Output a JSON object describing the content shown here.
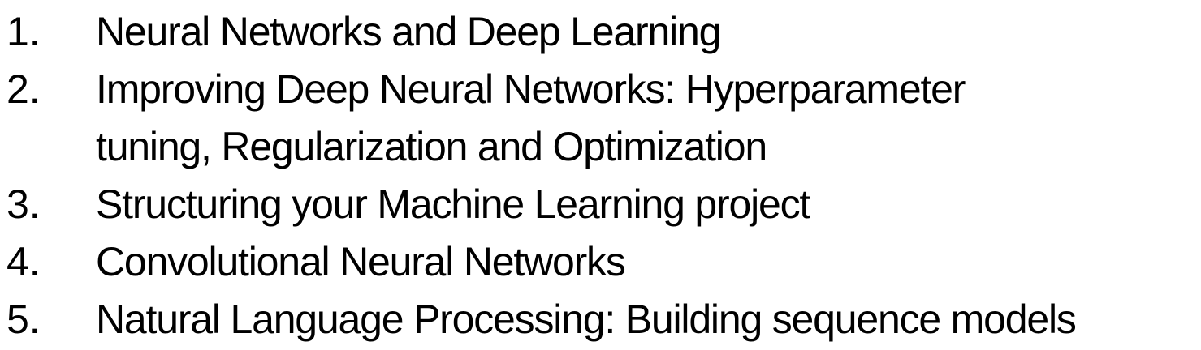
{
  "items": [
    {
      "number": "1.",
      "text": "Neural Networks and Deep Learning"
    },
    {
      "number": "2.",
      "text": "Improving Deep Neural Networks: Hyperparameter\ntuning, Regularization and Optimization"
    },
    {
      "number": "3.",
      "text": "Structuring your Machine Learning project"
    },
    {
      "number": "4.",
      "text": "Convolutional Neural Networks"
    },
    {
      "number": "5.",
      "text": "Natural Language Processing: Building sequence models"
    }
  ]
}
